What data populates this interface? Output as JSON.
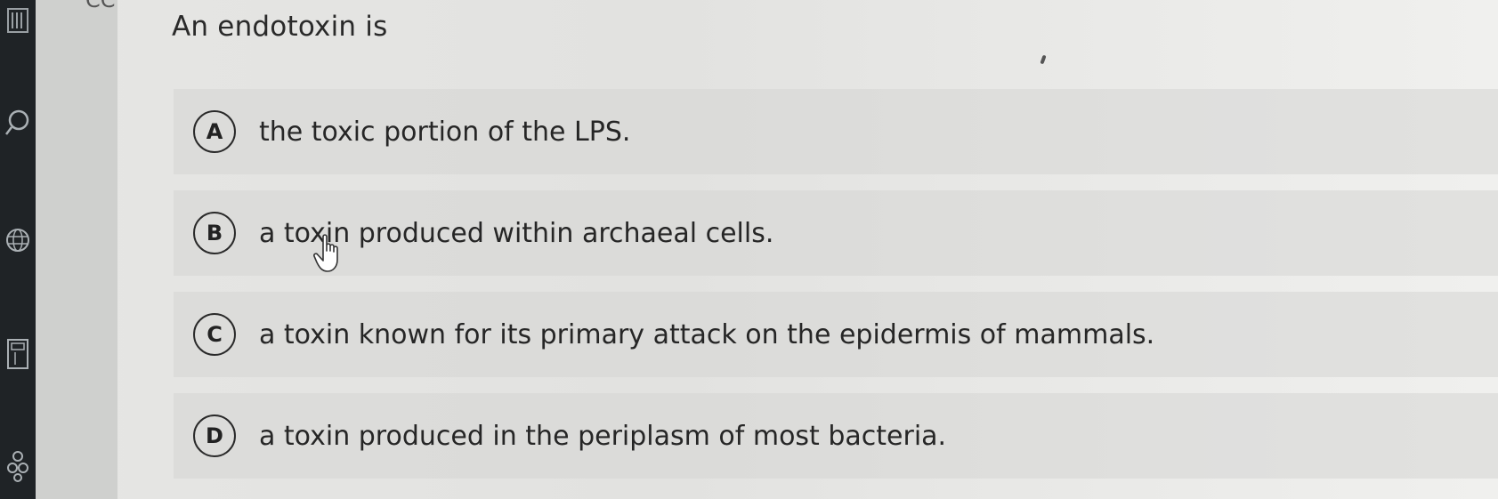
{
  "question": {
    "text": "An endotoxin is"
  },
  "top_cut_text": "CC",
  "options": [
    {
      "letter": "A",
      "text": "the toxic portion of the LPS."
    },
    {
      "letter": "B",
      "text": "a toxin produced within archaeal cells."
    },
    {
      "letter": "C",
      "text": "a toxin known for its primary attack on the epidermis of mammals."
    },
    {
      "letter": "D",
      "text": "a toxin produced in the periplasm of most bacteria."
    }
  ],
  "icons": {
    "rail": [
      "menu-icon",
      "search-icon",
      "globe-icon",
      "calculator-icon",
      "accessibility-icon"
    ],
    "pointer": "hand-pointer-icon"
  },
  "colors": {
    "background": "#e4e4e2",
    "option_background": "#d6d6d4",
    "rail": "#1f2326",
    "text": "#262626"
  }
}
